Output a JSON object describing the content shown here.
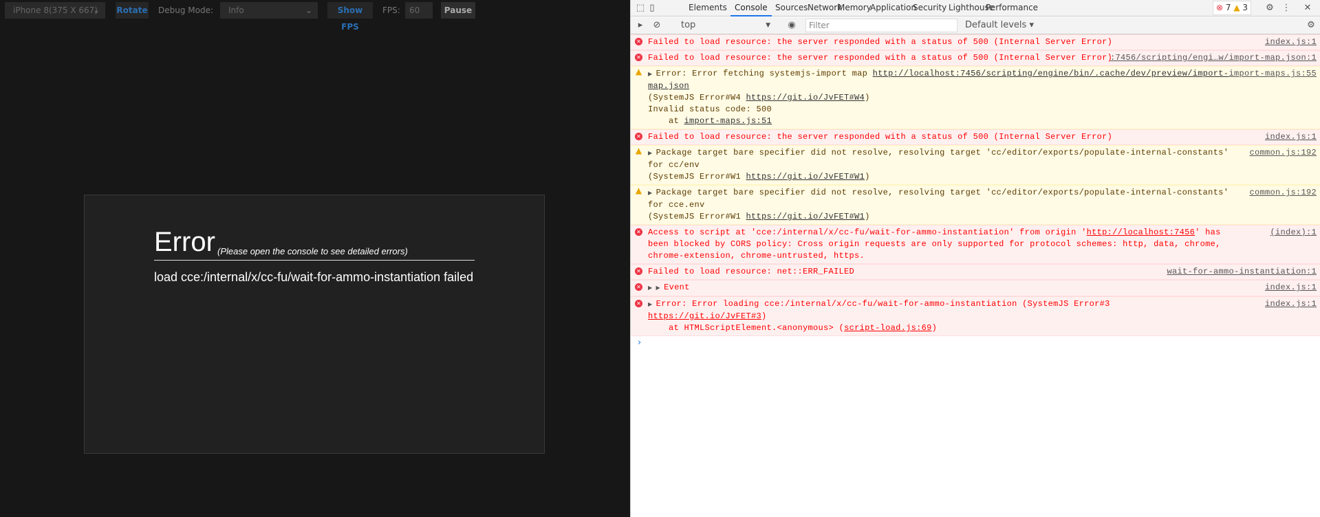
{
  "preview_toolbar": {
    "device": "iPhone 8(375 X 667)",
    "rotate": "Rotate",
    "debug_label": "Debug Mode:",
    "debug_value": "Info",
    "show_fps": "Show FPS",
    "fps_label": "FPS:",
    "fps_value": "60",
    "pause": "Pause"
  },
  "error_panel": {
    "title": "Error",
    "subtitle": "(Please open the console to see detailed errors)",
    "message": "load cce:/internal/x/cc-fu/wait-for-ammo-instantiation failed"
  },
  "devtools": {
    "tabs": [
      "Elements",
      "Console",
      "Sources",
      "Network",
      "Memory",
      "Application",
      "Security",
      "Lighthouse",
      "Performance"
    ],
    "active_tab": "Console",
    "error_count": "7",
    "warning_count": "3",
    "context": "top",
    "filter_placeholder": "Filter",
    "levels": "Default levels ▾"
  },
  "console": [
    {
      "type": "error",
      "text": "Failed to load resource: the server responded with a status of 500 (Internal Server Error)",
      "source": "index.js:1"
    },
    {
      "type": "error",
      "text": "Failed to load resource: the server responded with a status of 500 (Internal Server Error)",
      "source": ":7456/scripting/engi…w/import-map.json:1"
    },
    {
      "type": "warning",
      "pre": "Error: Error fetching systemjs-import map ",
      "link": "http://localhost:7456/scripting/engine/bin/.cache/dev/preview/import-map.json",
      "line2pre": "(SystemJS Error#W4 ",
      "link2": "https://git.io/JvFET#W4",
      "line2post": ")",
      "line3": "Invalid status code: 500",
      "line4pre": "    at ",
      "link3": "import-maps.js:51",
      "source": "import-maps.js:55"
    },
    {
      "type": "error",
      "text": "Failed to load resource: the server responded with a status of 500 (Internal Server Error)",
      "source": "index.js:1"
    },
    {
      "type": "warning",
      "pre": "Package target bare specifier did not resolve, resolving target 'cc/editor/exports/populate-internal-constants' for cc/env",
      "line2pre": "(SystemJS Error#W1 ",
      "link2": "https://git.io/JvFET#W1",
      "line2post": ")",
      "source": "common.js:192"
    },
    {
      "type": "warning",
      "pre": "Package target bare specifier did not resolve, resolving target 'cc/editor/exports/populate-internal-constants' for cce.env",
      "line2pre": "(SystemJS Error#W1 ",
      "link2": "https://git.io/JvFET#W1",
      "line2post": ")",
      "source": "common.js:192"
    },
    {
      "type": "error",
      "pre": "Access to script at 'cce:/internal/x/cc-fu/wait-for-ammo-instantiation' from origin '",
      "link": "http://localhost:7456",
      "post": "' has been blocked by CORS policy: Cross origin requests are only supported for protocol schemes: http, data, chrome, chrome-extension, chrome-untrusted, https.",
      "source": "(index):1"
    },
    {
      "type": "error",
      "text": "Failed to load resource: net::ERR_FAILED",
      "source": "wait-for-ammo-instantiation:1"
    },
    {
      "type": "error",
      "text": "Event",
      "source": "index.js:1"
    },
    {
      "type": "error",
      "pre": "Error: Error loading cce:/internal/x/cc-fu/wait-for-ammo-instantiation (SystemJS Error#3 ",
      "link": "https://git.io/JvFET#3",
      "post": ")",
      "line2pre": "    at HTMLScriptElement.<anonymous> (",
      "link2": "script-load.js:69",
      "line2post": ")",
      "source": "index.js:1"
    }
  ]
}
